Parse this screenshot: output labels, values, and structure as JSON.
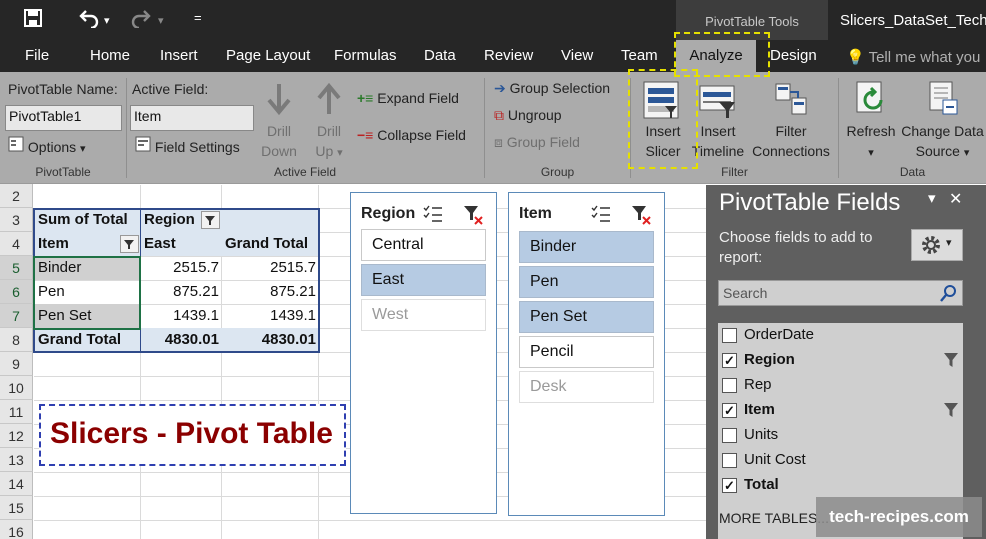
{
  "quick_access": {
    "save_icon": "save-icon",
    "undo_icon": "undo-icon",
    "redo_icon": "redo-icon",
    "customize_icon": "customize-qat-icon",
    "undo_arrow": "▾",
    "redo_arrow": "▾",
    "customize_glyph": "="
  },
  "title_bar": {
    "contextual_tab_group": "PivotTable Tools",
    "document_title": "Slicers_DataSet_TechR"
  },
  "tabs": [
    {
      "label": "File"
    },
    {
      "label": "Home"
    },
    {
      "label": "Insert"
    },
    {
      "label": "Page Layout"
    },
    {
      "label": "Formulas"
    },
    {
      "label": "Data"
    },
    {
      "label": "Review"
    },
    {
      "label": "View"
    },
    {
      "label": "Team"
    },
    {
      "label": "Analyze"
    },
    {
      "label": "Design"
    }
  ],
  "tell_me": "Tell me what you",
  "ribbon": {
    "pivottable": {
      "name_label": "PivotTable Name:",
      "name_value": "PivotTable1",
      "options_label": "Options",
      "options_arrow": "▾",
      "group_label": "PivotTable"
    },
    "active_field": {
      "label": "Active Field:",
      "value": "Item",
      "settings_label": "Field Settings",
      "drill_down_1": "Drill",
      "drill_down_2": "Down",
      "drill_up_1": "Drill",
      "drill_up_2": "Up",
      "drill_up_arrow": "▾",
      "expand_label": "Expand Field",
      "collapse_label": "Collapse Field",
      "group_label": "Active Field"
    },
    "group": {
      "group_selection": "Group Selection",
      "ungroup": "Ungroup",
      "group_field": "Group Field",
      "group_label": "Group"
    },
    "filter": {
      "insert_slicer_1": "Insert",
      "insert_slicer_2": "Slicer",
      "insert_timeline_1": "Insert",
      "insert_timeline_2": "Timeline",
      "filter_connections_1": "Filter",
      "filter_connections_2": "Connections",
      "group_label": "Filter"
    },
    "data": {
      "refresh": "Refresh",
      "refresh_arrow": "▾",
      "change_source_1": "Change Data",
      "change_source_2": "Source",
      "change_source_arrow": "▾",
      "group_label": "Data"
    }
  },
  "accent_colors": {
    "highlight_dashes": "#e5e000",
    "slicer_selected": "#b6cbe3",
    "title_text": "#8b0000",
    "pivot_header": "#dce6f1"
  },
  "grid": {
    "row_numbers": [
      "2",
      "3",
      "4",
      "5",
      "6",
      "7",
      "8",
      "9",
      "10",
      "11",
      "12",
      "13",
      "14",
      "15",
      "16"
    ],
    "pivot": {
      "corner_label": "Sum of Total",
      "column_header": "Region",
      "item_header": "Item",
      "col_east": "East",
      "col_grand_total": "Grand Total",
      "rows": [
        {
          "item": "Binder",
          "east": "2515.7",
          "total": "2515.7"
        },
        {
          "item": "Pen",
          "east": "875.21",
          "total": "875.21"
        },
        {
          "item": "Pen Set",
          "east": "1439.1",
          "total": "1439.1"
        }
      ],
      "grand_total_label": "Grand Total",
      "grand_total_east": "4830.01",
      "grand_total_total": "4830.01"
    },
    "banner_text": "Slicers - Pivot Table"
  },
  "slicers": [
    {
      "title": "Region",
      "items": [
        {
          "label": "Central",
          "state": "normal"
        },
        {
          "label": "East",
          "state": "selected"
        },
        {
          "label": "West",
          "state": "nodata"
        }
      ]
    },
    {
      "title": "Item",
      "items": [
        {
          "label": "Binder",
          "state": "selected"
        },
        {
          "label": "Pen",
          "state": "selected"
        },
        {
          "label": "Pen Set",
          "state": "selected"
        },
        {
          "label": "Pencil",
          "state": "normal"
        },
        {
          "label": "Desk",
          "state": "nodata"
        }
      ]
    }
  ],
  "field_pane": {
    "title": "PivotTable Fields",
    "dropdown_glyph": "▾",
    "close_glyph": "✕",
    "choose_text": "Choose fields to add to report:",
    "search_placeholder": "Search",
    "fields": [
      {
        "label": "OrderDate",
        "checked": false,
        "bold": false,
        "filtered": false
      },
      {
        "label": "Region",
        "checked": true,
        "bold": true,
        "filtered": true
      },
      {
        "label": "Rep",
        "checked": false,
        "bold": false,
        "filtered": false
      },
      {
        "label": "Item",
        "checked": true,
        "bold": true,
        "filtered": true
      },
      {
        "label": "Units",
        "checked": false,
        "bold": false,
        "filtered": false
      },
      {
        "label": "Unit Cost",
        "checked": false,
        "bold": false,
        "filtered": false
      },
      {
        "label": "Total",
        "checked": true,
        "bold": true,
        "filtered": false
      }
    ],
    "more_tables": "MORE TABLES..."
  },
  "watermark": "tech-recipes.com"
}
